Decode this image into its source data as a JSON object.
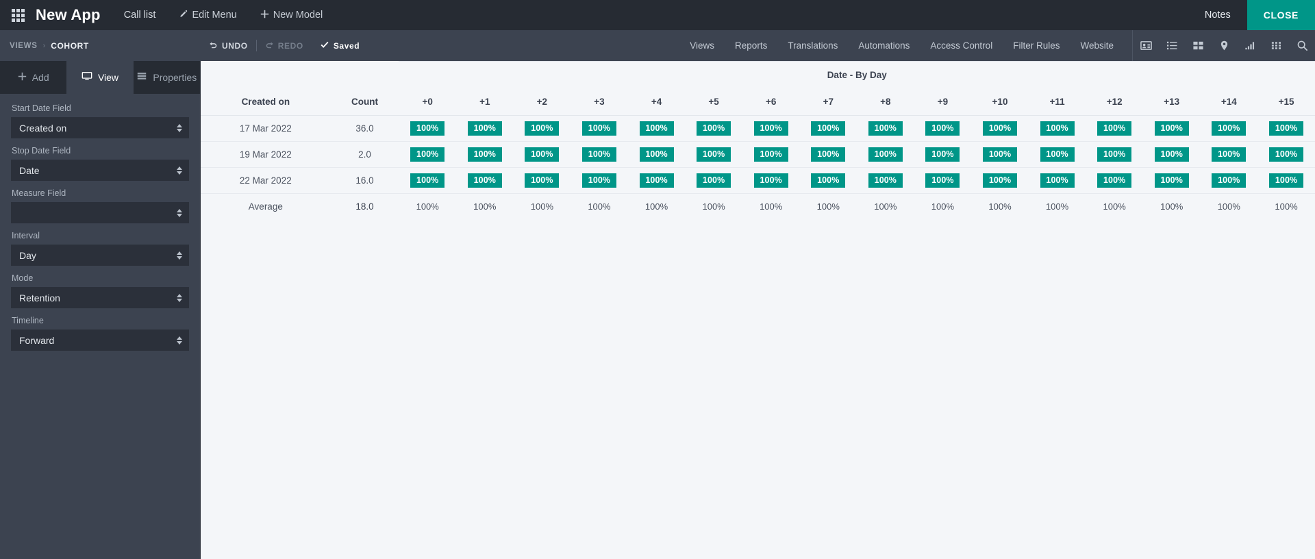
{
  "topbar": {
    "apps_icon": "apps-grid-icon",
    "app_title": "New App",
    "links": [
      {
        "label": "Call list",
        "icon": null
      },
      {
        "label": "Edit Menu",
        "icon": "pencil-icon"
      },
      {
        "label": "New Model",
        "icon": "plus-icon"
      }
    ],
    "notes_label": "Notes",
    "close_label": "CLOSE",
    "close_color": "#009688"
  },
  "subbar": {
    "breadcrumb": {
      "root": "VIEWS",
      "separator": "›",
      "current": "COHORT"
    },
    "undo_label": "UNDO",
    "redo_label": "REDO",
    "saved_label": "Saved",
    "links": [
      "Views",
      "Reports",
      "Translations",
      "Automations",
      "Access Control",
      "Filter Rules",
      "Website"
    ],
    "view_icons": [
      "contact-card-icon",
      "list-icon",
      "kanban-icon",
      "map-pin-icon",
      "bar-chart-icon",
      "cohort-grid-icon",
      "search-icon"
    ]
  },
  "sidebar": {
    "tabs": [
      {
        "label": "Add",
        "icon": "plus-icon",
        "active": false
      },
      {
        "label": "View",
        "icon": "monitor-icon",
        "active": true
      },
      {
        "label": "Properties",
        "icon": "properties-icon",
        "active": false
      }
    ],
    "fields": [
      {
        "label": "Start Date Field",
        "value": "Created on",
        "placeholder": ""
      },
      {
        "label": "Stop Date Field",
        "value": "Date",
        "placeholder": ""
      },
      {
        "label": "Measure Field",
        "value": "",
        "placeholder": ""
      },
      {
        "label": "Interval",
        "value": "Day",
        "placeholder": ""
      },
      {
        "label": "Mode",
        "value": "Retention",
        "placeholder": ""
      },
      {
        "label": "Timeline",
        "value": "Forward",
        "placeholder": ""
      }
    ]
  },
  "chart_data": {
    "type": "table",
    "title": "Date - By Day",
    "group_header": "Date - By Day",
    "row_header": "Created on",
    "count_header": "Count",
    "categories": [
      "+0",
      "+1",
      "+2",
      "+3",
      "+4",
      "+5",
      "+6",
      "+7",
      "+8",
      "+9",
      "+10",
      "+11",
      "+12",
      "+13",
      "+14",
      "+15"
    ],
    "cell_color": "#009688",
    "rows": [
      {
        "label": "17 Mar 2022",
        "count": "36.0",
        "values": [
          "100%",
          "100%",
          "100%",
          "100%",
          "100%",
          "100%",
          "100%",
          "100%",
          "100%",
          "100%",
          "100%",
          "100%",
          "100%",
          "100%",
          "100%",
          "100%"
        ]
      },
      {
        "label": "19 Mar 2022",
        "count": "2.0",
        "values": [
          "100%",
          "100%",
          "100%",
          "100%",
          "100%",
          "100%",
          "100%",
          "100%",
          "100%",
          "100%",
          "100%",
          "100%",
          "100%",
          "100%",
          "100%",
          "100%"
        ]
      },
      {
        "label": "22 Mar 2022",
        "count": "16.0",
        "values": [
          "100%",
          "100%",
          "100%",
          "100%",
          "100%",
          "100%",
          "100%",
          "100%",
          "100%",
          "100%",
          "100%",
          "100%",
          "100%",
          "100%",
          "100%",
          "100%"
        ]
      }
    ],
    "summary": {
      "label": "Average",
      "count": "18.0",
      "values": [
        "100%",
        "100%",
        "100%",
        "100%",
        "100%",
        "100%",
        "100%",
        "100%",
        "100%",
        "100%",
        "100%",
        "100%",
        "100%",
        "100%",
        "100%",
        "100%"
      ]
    }
  }
}
